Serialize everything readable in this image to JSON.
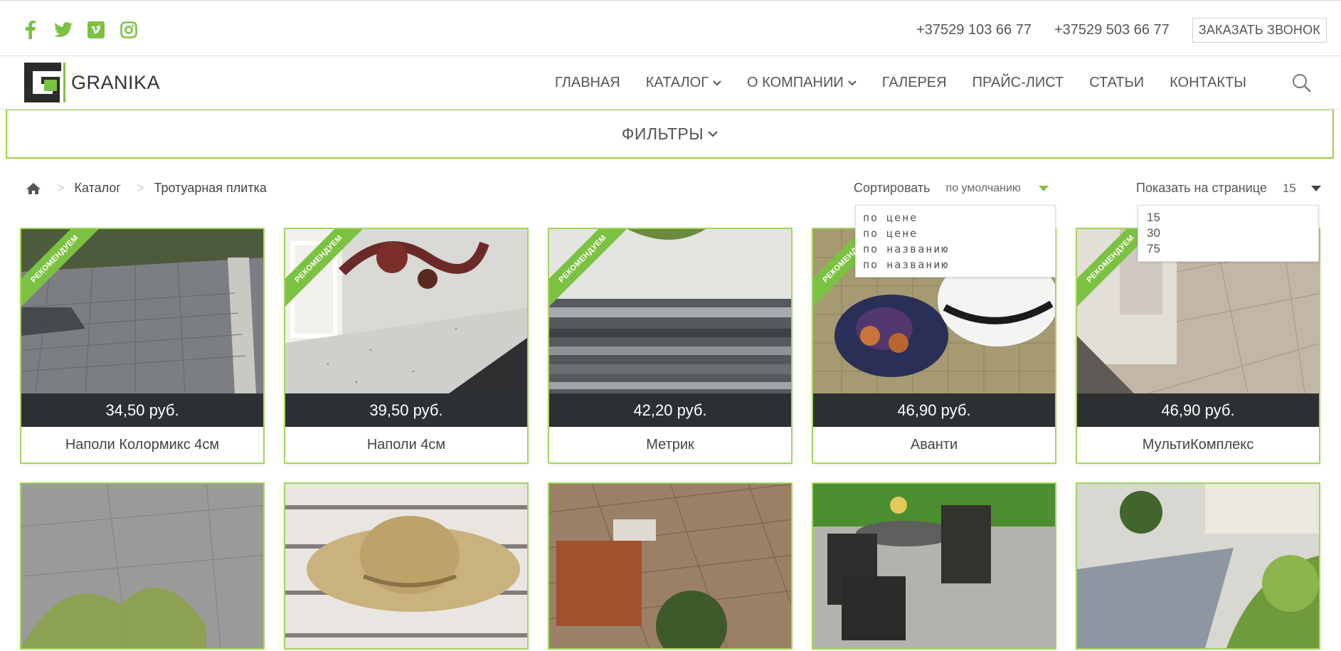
{
  "topbar": {
    "social": [
      "facebook-icon",
      "twitter-icon",
      "vimeo-icon",
      "instagram-icon"
    ],
    "phone1": "+37529 103 66 77",
    "phone2": "+37529 503 66 77",
    "callback": "ЗАКАЗАТЬ ЗВОНОК"
  },
  "header": {
    "logo_text": "GRANIKA",
    "nav": [
      {
        "label": "ГЛАВНАЯ"
      },
      {
        "label": "КАТАЛОГ"
      },
      {
        "label": "О КОМПАНИИ"
      },
      {
        "label": "ГАЛЕРЕЯ"
      },
      {
        "label": "ПРАЙС-ЛИСТ"
      },
      {
        "label": "СТАТЬИ"
      },
      {
        "label": "КОНТАКТЫ"
      }
    ]
  },
  "filters": {
    "label": "ФИЛЬТРЫ"
  },
  "breadcrumbs": {
    "items": [
      "Каталог",
      "Тротуарная плитка"
    ]
  },
  "sort": {
    "label": "Сортировать",
    "value": "по умолчанию",
    "options": [
      "по цене",
      "по цене",
      "по названию",
      "по названию"
    ]
  },
  "perpage": {
    "label": "Показать на странице",
    "value": "15",
    "options": [
      "15",
      "30",
      "75"
    ]
  },
  "products": [
    {
      "price": "34,50 руб.",
      "name": "Наполи Колормикс 4см",
      "badge": "РЕКОМЕНДУЕМ"
    },
    {
      "price": "39,50 руб.",
      "name": "Наполи 4см",
      "badge": "РЕКОМЕНДУЕМ"
    },
    {
      "price": "42,20 руб.",
      "name": "Метрик",
      "badge": "РЕКОМЕНДУЕМ"
    },
    {
      "price": "46,90 руб.",
      "name": "Аванти",
      "badge": "РЕКОМЕНДУЕМ"
    },
    {
      "price": "46,90 руб.",
      "name": "МультиКомплекс",
      "badge": "РЕКОМЕНДУЕМ"
    }
  ],
  "colors": {
    "accent": "#7cc242",
    "price_bar": "#2d3033"
  }
}
